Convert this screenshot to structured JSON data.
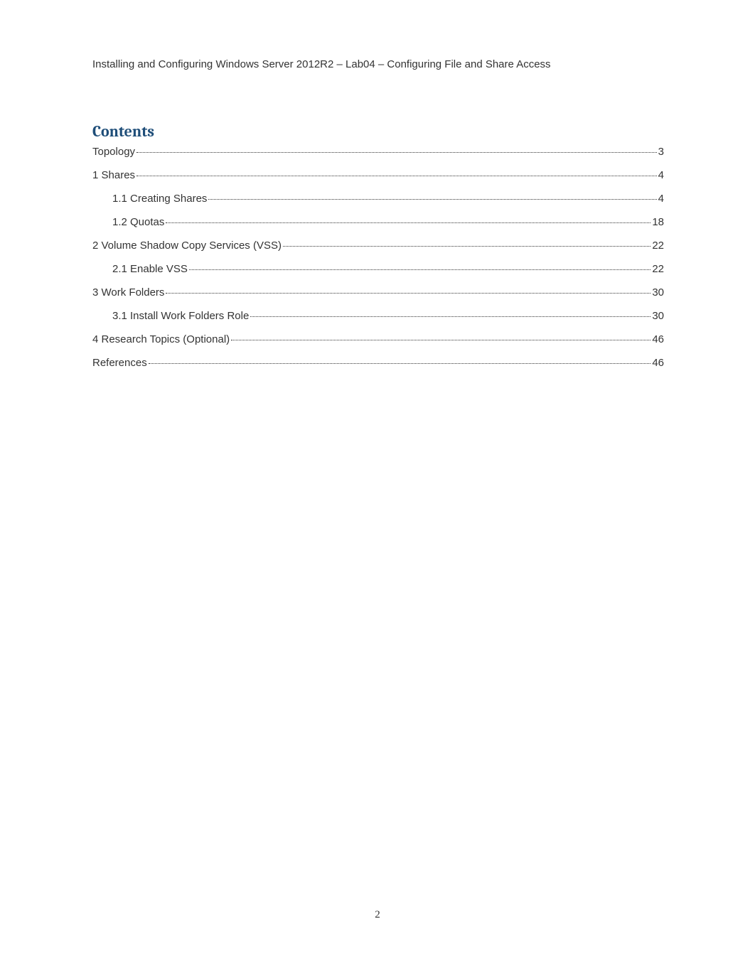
{
  "header": "Installing and Configuring Windows Server 2012R2 – Lab04 – Configuring File and Share Access",
  "contents_title": "Contents",
  "toc": [
    {
      "level": 1,
      "label": "Topology",
      "page": "3"
    },
    {
      "level": 1,
      "label": "1  Shares",
      "page": "4"
    },
    {
      "level": 2,
      "label": "1.1  Creating Shares",
      "page": "4"
    },
    {
      "level": 2,
      "label": "1.2  Quotas",
      "page": "18"
    },
    {
      "level": 1,
      "label": "2  Volume Shadow Copy Services (VSS)",
      "page": "22"
    },
    {
      "level": 2,
      "label": "2.1  Enable VSS",
      "page": "22"
    },
    {
      "level": 1,
      "label": "3  Work Folders",
      "page": "30"
    },
    {
      "level": 2,
      "label": "3.1  Install Work Folders Role",
      "page": "30"
    },
    {
      "level": 1,
      "label": "4  Research Topics (Optional)",
      "page": "46"
    },
    {
      "level": 1,
      "label": "References",
      "page": "46"
    }
  ],
  "page_number": "2"
}
